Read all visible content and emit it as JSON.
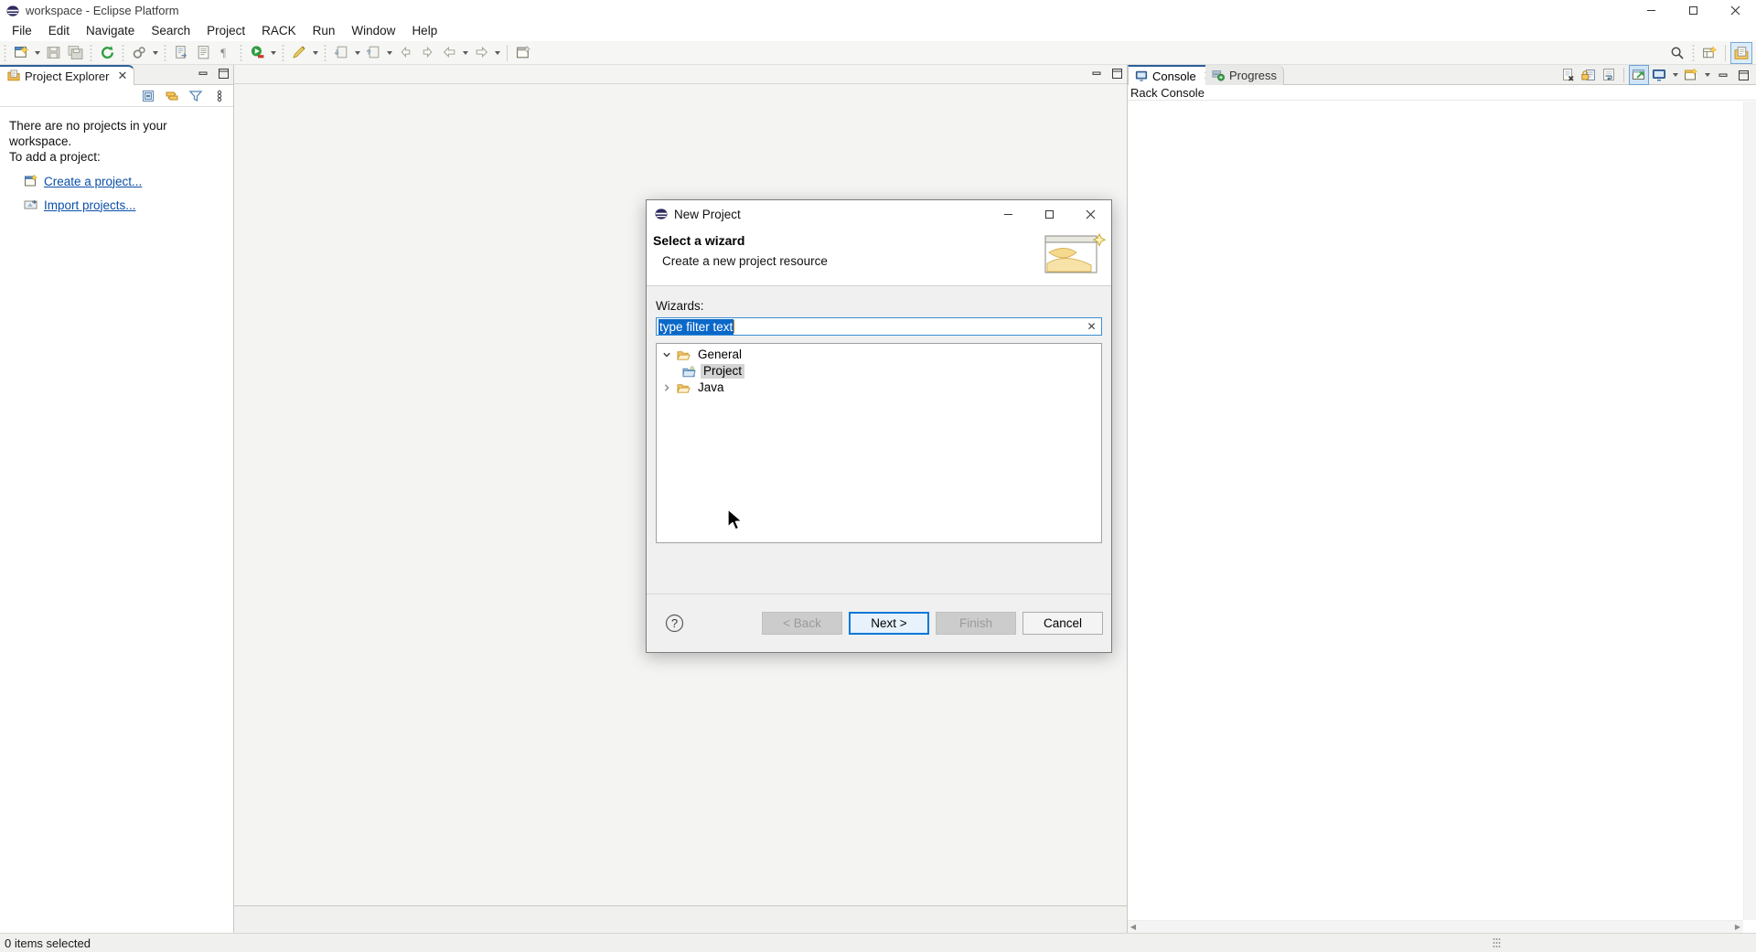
{
  "window": {
    "title": "workspace - Eclipse Platform",
    "app_icon": "eclipse-icon",
    "minimize": "–",
    "maximize": "❐",
    "close": "✕"
  },
  "menubar": {
    "items": [
      {
        "label": "File"
      },
      {
        "label": "Edit"
      },
      {
        "label": "Navigate"
      },
      {
        "label": "Search"
      },
      {
        "label": "Project"
      },
      {
        "label": "RACK"
      },
      {
        "label": "Run"
      },
      {
        "label": "Window"
      },
      {
        "label": "Help"
      }
    ]
  },
  "toolbar": {
    "items": [
      {
        "name": "new-wizard-icon",
        "has_arrow": true
      },
      {
        "name": "save-icon",
        "has_arrow": false
      },
      {
        "name": "save-all-icon",
        "has_arrow": false
      },
      {
        "name": "refresh-icon",
        "has_arrow": false
      },
      {
        "name": "build-gears-icon",
        "has_arrow": true
      },
      {
        "name": "open-type-icon",
        "has_arrow": false
      },
      {
        "name": "toggle-block-selection-icon",
        "has_arrow": false
      },
      {
        "name": "show-whitespace-icon",
        "has_arrow": false
      },
      {
        "name": "run-icon",
        "has_arrow": true
      },
      {
        "name": "external-tools-icon",
        "has_arrow": true
      },
      {
        "name": "skip-breakpoints-icon",
        "has_arrow": true
      },
      {
        "name": "open-resource-icon",
        "has_arrow": true
      },
      {
        "name": "back-nav-icon",
        "has_arrow": false
      },
      {
        "name": "forward-nav-icon",
        "has_arrow": false
      },
      {
        "name": "previous-annotation-icon",
        "has_arrow": true
      },
      {
        "name": "next-annotation-icon",
        "has_arrow": true
      },
      {
        "name": "new-editor-icon",
        "has_arrow": false
      }
    ],
    "right_items": [
      {
        "name": "search-icon"
      },
      {
        "name": "new-perspective-icon"
      },
      {
        "name": "perspective-resource-icon",
        "active": true
      }
    ]
  },
  "project_explorer": {
    "tab_label": "Project Explorer",
    "tab_icon": "project-explorer-icon",
    "close_glyph": "✕",
    "minimize_glyph": "–",
    "maximize_glyph": "❐",
    "tools": [
      {
        "name": "collapse-all-icon"
      },
      {
        "name": "link-with-editor-icon"
      },
      {
        "name": "view-filter-icon"
      },
      {
        "name": "view-menu-icon"
      }
    ],
    "empty_message_line1": "There are no projects in your workspace.",
    "empty_message_line2": "To add a project:",
    "links": [
      {
        "label": "Create a project...",
        "icon": "new-project-icon"
      },
      {
        "label": "Import projects...",
        "icon": "import-projects-icon"
      }
    ]
  },
  "editor_area": {
    "minimize_glyph": "–",
    "maximize_glyph": "❐"
  },
  "console_view": {
    "tabs": [
      {
        "label": "Console",
        "icon": "console-icon",
        "active": true,
        "close_glyph": "✕"
      },
      {
        "label": "Progress",
        "icon": "progress-icon",
        "active": false
      }
    ],
    "title": "Rack Console",
    "tools": [
      {
        "name": "clear-console-icon",
        "has_arrow": false
      },
      {
        "name": "scroll-lock-icon",
        "has_arrow": false
      },
      {
        "name": "word-wrap-icon",
        "has_arrow": false
      },
      {
        "name": "pin-console-icon",
        "has_arrow": false,
        "pressed": true
      },
      {
        "name": "display-selected-console-icon",
        "has_arrow": true
      },
      {
        "name": "open-console-icon",
        "has_arrow": true
      }
    ],
    "minimize_glyph": "–",
    "maximize_glyph": "❐",
    "scroll_left_glyph": "◀",
    "scroll_right_glyph": "▶"
  },
  "status_bar": {
    "text": "0 items selected"
  },
  "dialog": {
    "title": "New Project",
    "title_icon": "eclipse-icon",
    "minimize": "–",
    "maximize": "❐",
    "close": "✕",
    "heading": "Select a wizard",
    "subheading": "Create a new project resource",
    "banner_icon": "wizard-banner-icon",
    "wizards_label": "Wizards:",
    "filter": {
      "value": "type filter text",
      "placeholder": "type filter text",
      "selected": true,
      "clear_glyph": "✕"
    },
    "tree": [
      {
        "label": "General",
        "icon": "folder-open-icon",
        "expanded": true,
        "twisty": "⌄",
        "selected": false,
        "children": [
          {
            "label": "Project",
            "icon": "project-wizard-icon",
            "selected": true
          }
        ]
      },
      {
        "label": "Java",
        "icon": "folder-open-icon",
        "expanded": false,
        "twisty": "›",
        "selected": false,
        "children": []
      }
    ],
    "help_icon": "help-question-icon",
    "buttons": [
      {
        "label": "< Back",
        "state": "disabled",
        "name": "back-button"
      },
      {
        "label": "Next >",
        "state": "default",
        "name": "next-button"
      },
      {
        "label": "Finish",
        "state": "disabled",
        "name": "finish-button"
      },
      {
        "label": "Cancel",
        "state": "normal",
        "name": "cancel-button"
      }
    ]
  },
  "colors": {
    "accent_blue": "#0078d7",
    "tab_active_border": "#2d5f9a",
    "link_blue": "#0b4fa8",
    "selection_blue": "#0a68c9"
  }
}
